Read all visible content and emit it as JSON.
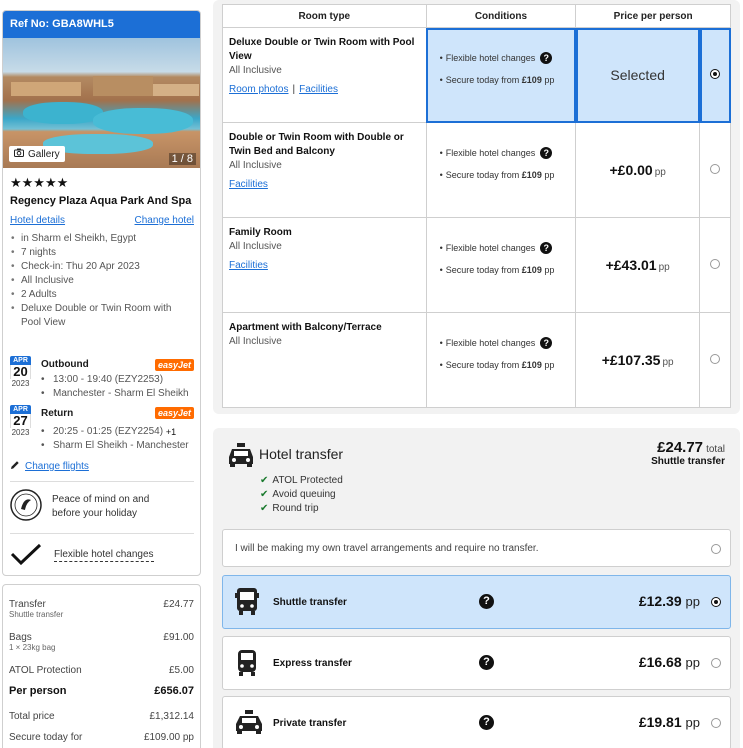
{
  "booking": {
    "ref": "Ref No: GBA8WHL5"
  },
  "gallery": {
    "label": "Gallery",
    "count": "1 / 8"
  },
  "hotel": {
    "stars": "★★★★★",
    "name": "Regency Plaza Aqua Park And Spa",
    "details_link": "Hotel details",
    "change_link": "Change hotel",
    "details": [
      "in Sharm el Sheikh, Egypt",
      "7 nights",
      "Check-in: Thu 20 Apr 2023",
      "All Inclusive",
      "2 Adults",
      "Deluxe Double or Twin Room with Pool View"
    ]
  },
  "flights": {
    "outbound": {
      "month": "APR",
      "day": "20",
      "year": "2023",
      "label": "Outbound",
      "airline": "easyJet",
      "times": "13:00 - 19:40 (EZY2253)",
      "route": "Manchester - Sharm El Sheikh"
    },
    "return": {
      "month": "APR",
      "day": "27",
      "year": "2023",
      "label": "Return",
      "airline": "easyJet",
      "times": "20:25 - 01:25 (EZY2254)",
      "plus": "+1",
      "route": "Sharm El Sheikh - Manchester"
    },
    "change_label": "Change flights"
  },
  "peace": {
    "text": "Peace of mind on and before your holiday"
  },
  "flexible": {
    "label": "Flexible hotel changes"
  },
  "summary": {
    "transfer": {
      "label": "Transfer",
      "sub": "Shuttle transfer",
      "value": "£24.77"
    },
    "bags": {
      "label": "Bags",
      "sub": "1 × 23kg bag",
      "value": "£91.00"
    },
    "atol": {
      "label": "ATOL Protection",
      "value": "£5.00"
    },
    "per_person": {
      "label": "Per person",
      "value": "£656.07"
    },
    "total": {
      "label": "Total price",
      "value": "£1,312.14"
    },
    "today": {
      "label": "Secure today for",
      "value": "£109.00 pp"
    }
  },
  "rooms": {
    "headers": {
      "type": "Room type",
      "conditions": "Conditions",
      "price": "Price per person"
    },
    "flex_label": "Flexible hotel changes",
    "secure_label": "Secure today from",
    "secure_amt": "£109",
    "secure_pp": "pp",
    "room_photos": "Room photos",
    "facilities": "Facilities",
    "items": [
      {
        "name": "Deluxe Double or Twin Room with Pool View",
        "board": "All Inclusive",
        "price": "Selected",
        "pp": ""
      },
      {
        "name": "Double or Twin Room with Double or Twin Bed and Balcony",
        "board": "All Inclusive",
        "price": "+£0.00",
        "pp": "pp"
      },
      {
        "name": "Family Room",
        "board": "All Inclusive",
        "price": "+£43.01",
        "pp": "pp"
      },
      {
        "name": "Apartment with Balcony/Terrace",
        "board": "All Inclusive",
        "price": "+£107.35",
        "pp": "pp"
      }
    ]
  },
  "transfer": {
    "title": "Hotel transfer",
    "total_amount": "£24.77",
    "total_label": "total",
    "total_type": "Shuttle transfer",
    "benefits": [
      "ATOL Protected",
      "Avoid queuing",
      "Round trip"
    ],
    "none_label": "I will be making my own travel arrangements and require no transfer.",
    "options": [
      {
        "label": "Shuttle transfer",
        "price": "£12.39",
        "pp": "pp"
      },
      {
        "label": "Express transfer",
        "price": "£16.68",
        "pp": "pp"
      },
      {
        "label": "Private transfer",
        "price": "£19.81",
        "pp": "pp"
      }
    ]
  },
  "colors": {
    "accent": "#1c6fd6",
    "selected_bg": "#cfe5fb",
    "easyjet": "#ff6b00",
    "check": "#1a7a2e"
  }
}
